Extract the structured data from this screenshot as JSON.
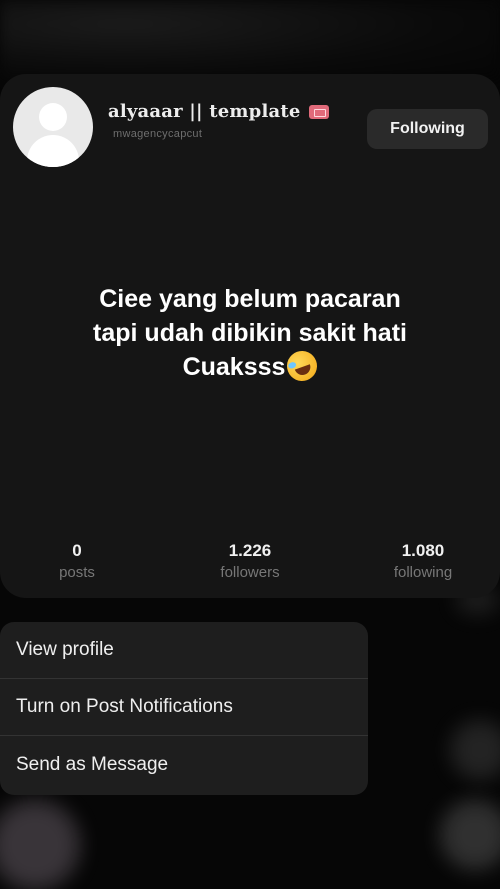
{
  "profile": {
    "username": "alyaaar || template",
    "subname": "mwagencycapcut",
    "follow_button_label": "Following",
    "bio_lines": [
      "Ciee yang belum pacaran",
      "tapi udah dibikin sakit hati",
      "Cuaksss"
    ],
    "bio_emoji": "rolling-on-floor-laughing-icon"
  },
  "stats": [
    {
      "value": "0",
      "label": "posts"
    },
    {
      "value": "1.226",
      "label": "followers"
    },
    {
      "value": "1.080",
      "label": "following"
    }
  ],
  "menu": {
    "items": [
      {
        "label": "View profile"
      },
      {
        "label": "Turn on Post Notifications"
      },
      {
        "label": "Send as Message"
      }
    ]
  },
  "colors": {
    "background": "#060606",
    "card": "#151515",
    "menu": "#1e1e1e",
    "button": "#2a2a2a"
  }
}
